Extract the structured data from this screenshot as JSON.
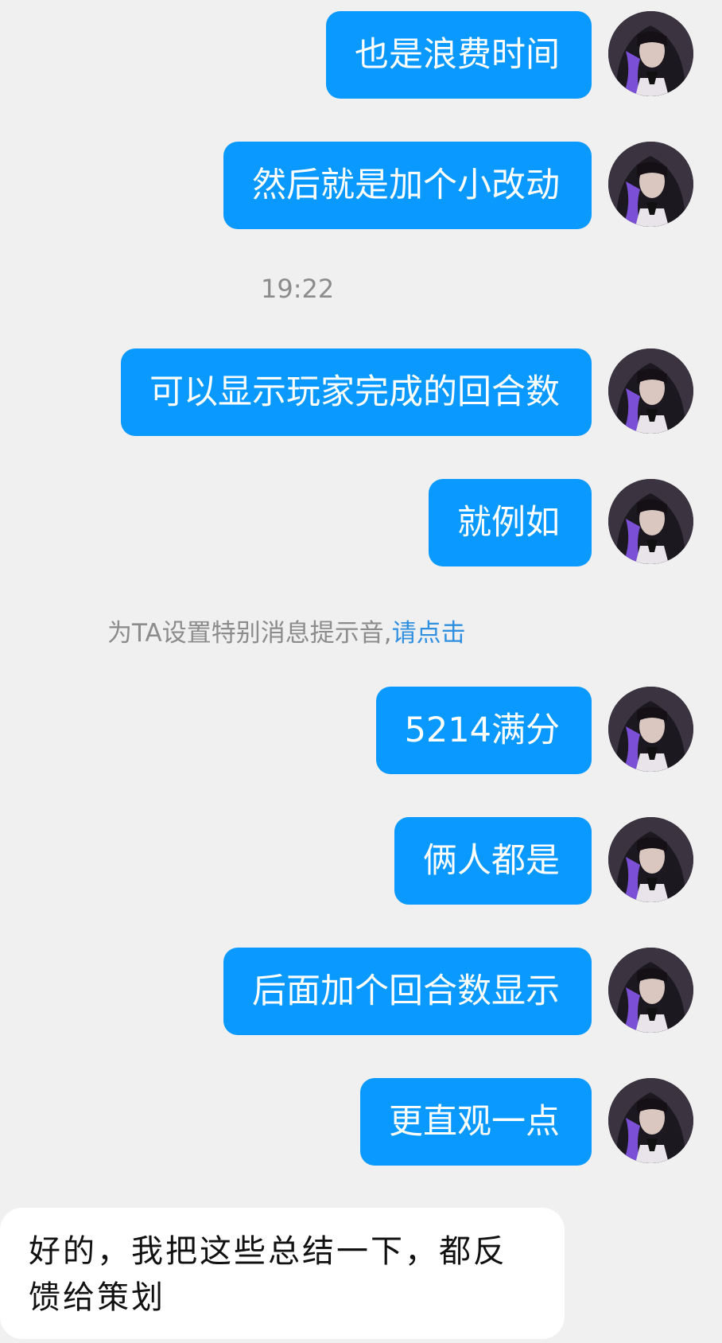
{
  "messages": [
    {
      "text": "也是浪费时间"
    },
    {
      "text": "然后就是加个小改动"
    },
    {
      "text": "可以显示玩家完成的回合数"
    },
    {
      "text": "就例如"
    },
    {
      "text": "5214满分"
    },
    {
      "text": "俩人都是"
    },
    {
      "text": "后面加个回合数显示"
    },
    {
      "text": "更直观一点"
    }
  ],
  "timestamp": "19:22",
  "system_tip": {
    "text": "为TA设置特别消息提示音,",
    "link": "请点击"
  },
  "input_text": "好的，我把这些总结一下，都反馈给策划",
  "colors": {
    "bubble": "#0a99ff",
    "background": "#f0f0f0",
    "link": "#2f8fe0"
  },
  "icons": {
    "avatar": "avatar-portrait"
  }
}
